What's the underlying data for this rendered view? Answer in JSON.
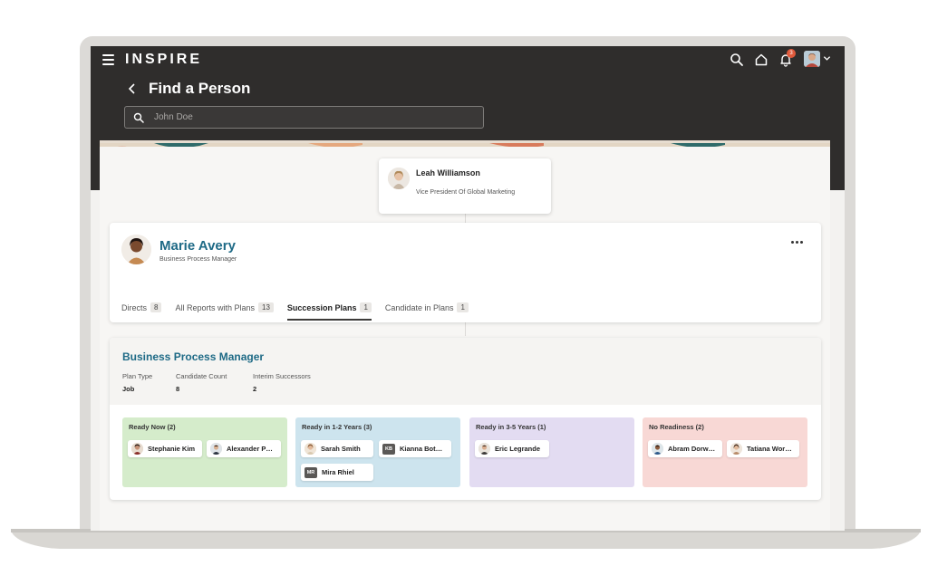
{
  "app": {
    "logo": "INSPIRE"
  },
  "header": {
    "title": "Find a Person",
    "search_placeholder": "John Doe",
    "notification_count": "3"
  },
  "manager": {
    "name": "Leah Williamson",
    "title": "Vice President Of Global Marketing"
  },
  "person": {
    "name": "Marie Avery",
    "title": "Business Process Manager"
  },
  "tabs": [
    {
      "label": "Directs",
      "count": "8"
    },
    {
      "label": "All Reports with Plans",
      "count": "13"
    },
    {
      "label": "Succession Plans",
      "count": "1"
    },
    {
      "label": "Candidate in Plans",
      "count": "1"
    }
  ],
  "plan": {
    "title": "Business Process Manager",
    "plan_type_label": "Plan Type",
    "plan_type_value": "Job",
    "candidate_count_label": "Candidate Count",
    "candidate_count_value": "8",
    "interim_label": "Interim Successors",
    "interim_value": "2",
    "columns": [
      {
        "title": "Ready Now (2)",
        "color": "#d5eccb",
        "candidates": [
          "Stephanie Kim",
          "Alexander Park"
        ]
      },
      {
        "title": "Ready in 1-2 Years (3)",
        "color": "#cde4ee",
        "candidates": [
          "Sarah Smith",
          "Kianna Botosh",
          "Mira Rhiel"
        ],
        "initials": {
          "1": "KB",
          "2": "MR"
        }
      },
      {
        "title": "Ready in 3-5 Years (1)",
        "color": "#e3dcf2",
        "candidates": [
          "Eric Legrande"
        ]
      },
      {
        "title": "No Readiness (2)",
        "color": "#f8d8d5",
        "candidates": [
          "Abram Dorwart",
          "Tatiana Work..."
        ]
      }
    ]
  },
  "colors": {
    "header_bg": "#2f2d2c",
    "accent": "#1e6a86"
  }
}
